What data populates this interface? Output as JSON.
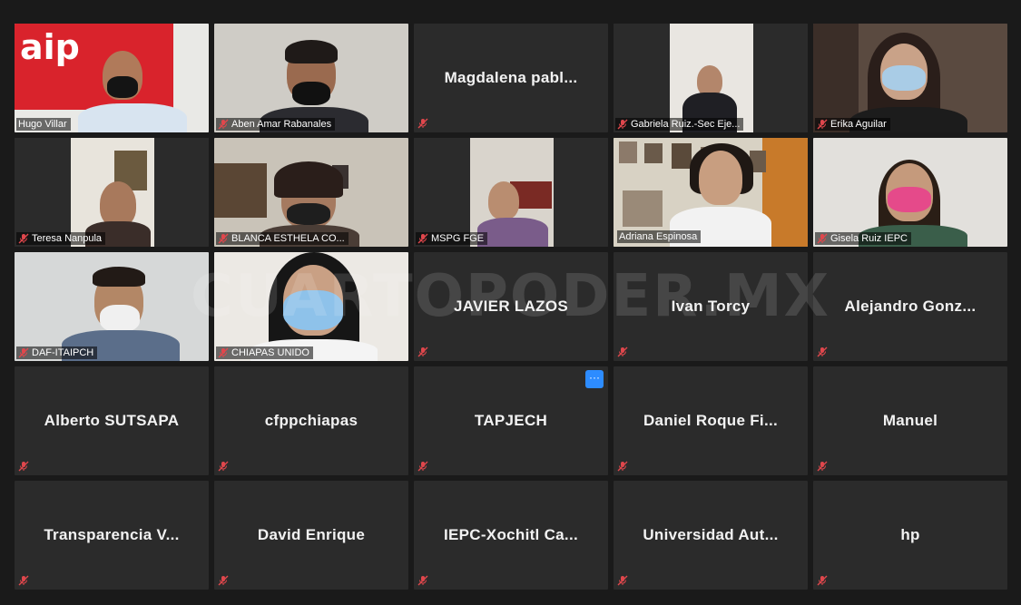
{
  "meeting": {
    "watermark": "CUARTOPODER.MX",
    "more_options_label": "···",
    "colors": {
      "background": "#1a1a1a",
      "tile": "#2b2b2b",
      "active_speaker": "#c9d84f",
      "muted": "#e0474c",
      "accent": "#2d8cff"
    },
    "participants": [
      {
        "name": "Hugo Villar",
        "type": "video",
        "muted": false
      },
      {
        "name": "Aben Amar Rabanales",
        "type": "video",
        "muted": true
      },
      {
        "name": "Magdalena  pabl...",
        "type": "name",
        "muted": true
      },
      {
        "name": "Gabriela Ruiz.-Sec Eje...",
        "type": "video",
        "muted": true
      },
      {
        "name": "Erika Aguilar",
        "type": "video",
        "muted": true
      },
      {
        "name": "Teresa Nanpula",
        "type": "video",
        "muted": true
      },
      {
        "name": "BLANCA ESTHELA CO...",
        "type": "video",
        "muted": true
      },
      {
        "name": "MSPG FGE",
        "type": "video",
        "muted": true
      },
      {
        "name": "Adriana Espinosa",
        "type": "video",
        "muted": false,
        "active": true
      },
      {
        "name": "Gisela Ruiz IEPC",
        "type": "video",
        "muted": true
      },
      {
        "name": "DAF-ITAIPCH",
        "type": "video",
        "muted": true
      },
      {
        "name": "CHIAPAS UNIDO",
        "type": "video",
        "muted": true
      },
      {
        "name": "JAVIER LAZOS",
        "type": "name",
        "muted": true
      },
      {
        "name": "Ivan Torcy",
        "type": "name",
        "muted": true
      },
      {
        "name": "Alejandro  Gonz...",
        "type": "name",
        "muted": true
      },
      {
        "name": "Alberto SUTSAPA",
        "type": "name",
        "muted": true
      },
      {
        "name": "cfppchiapas",
        "type": "name",
        "muted": true
      },
      {
        "name": "TAPJECH",
        "type": "name",
        "muted": true
      },
      {
        "name": "Daniel  Roque  Fi...",
        "type": "name",
        "muted": true
      },
      {
        "name": "Manuel",
        "type": "name",
        "muted": true
      },
      {
        "name": "Transparencia  V...",
        "type": "name",
        "muted": true
      },
      {
        "name": "David Enrique",
        "type": "name",
        "muted": true
      },
      {
        "name": "IEPC-Xochitl  Ca...",
        "type": "name",
        "muted": true
      },
      {
        "name": "Universidad  Aut...",
        "type": "name",
        "muted": true
      },
      {
        "name": "hp",
        "type": "name",
        "muted": true
      }
    ]
  }
}
